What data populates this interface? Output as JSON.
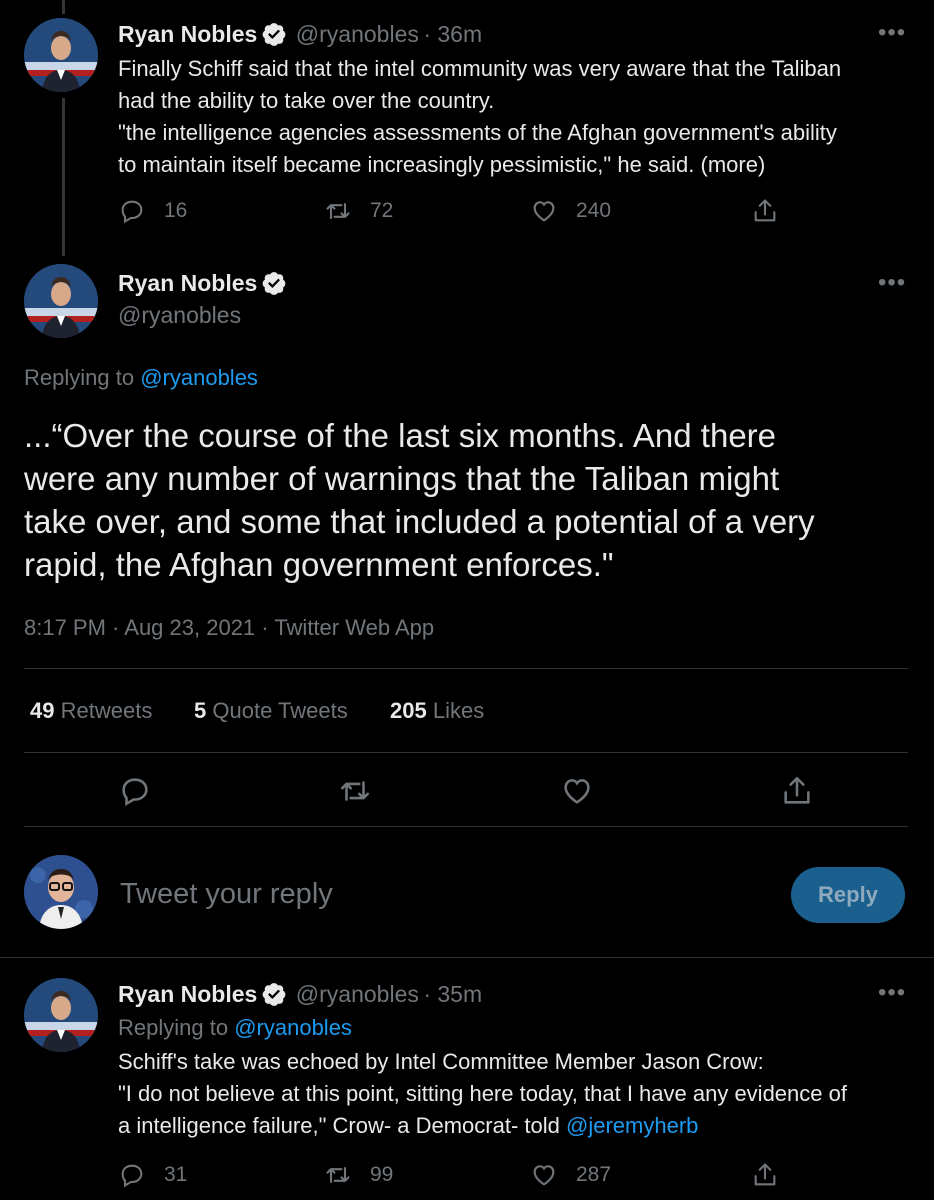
{
  "tweets": [
    {
      "name": "Ryan Nobles",
      "handle": "@ryanobles",
      "time": "· 36m",
      "text_lines": [
        "Finally Schiff said that the intel community was very aware that the Taliban",
        "had the ability to take over the country.",
        "\"the intelligence agencies assessments of the Afghan government's ability",
        "to maintain itself became increasingly pessimistic,\" he said.  (more)"
      ],
      "replies": "16",
      "retweets": "72",
      "likes": "240"
    }
  ],
  "main": {
    "name": "Ryan Nobles",
    "handle": "@ryanobles",
    "replying_prefix": "Replying to",
    "replying_to": "@ryanobles",
    "text_lines": [
      "...“Over the course of the last six months. And there",
      "were any number of warnings that the Taliban might",
      "take over, and some that included a potential of a very",
      "rapid, the Afghan government enforces.\""
    ],
    "timestamp": "8:17 PM · Aug 23, 2021 · Twitter Web App",
    "stats": {
      "retweets_count": "49",
      "retweets_label": "Retweets",
      "quotes_count": "5",
      "quotes_label": "Quote Tweets",
      "likes_count": "205",
      "likes_label": "Likes"
    }
  },
  "composer": {
    "placeholder": "Tweet your reply",
    "button": "Reply"
  },
  "reply_tweet": {
    "name": "Ryan Nobles",
    "handle": "@ryanobles",
    "time": "· 35m",
    "replying_prefix": "Replying to",
    "replying_to": "@ryanobles",
    "line1": "Schiff's take was echoed by Intel Committee Member Jason Crow:",
    "line2": "\"I do not believe at this point, sitting here today, that I have any evidence of",
    "line3_prefix": "a intelligence failure,\" Crow- a Democrat- told",
    "line3_mention": "@jeremyherb",
    "replies": "31",
    "retweets": "99",
    "likes": "287"
  },
  "icons": {
    "verified": "verified-badge-icon",
    "more": "more-icon",
    "reply": "reply-icon",
    "retweet": "retweet-icon",
    "like": "like-icon",
    "share": "share-icon"
  },
  "colors": {
    "background": "#000000",
    "link": "#1d9bf0",
    "muted": "#71767b",
    "reply_button": "#1a5f8e"
  }
}
